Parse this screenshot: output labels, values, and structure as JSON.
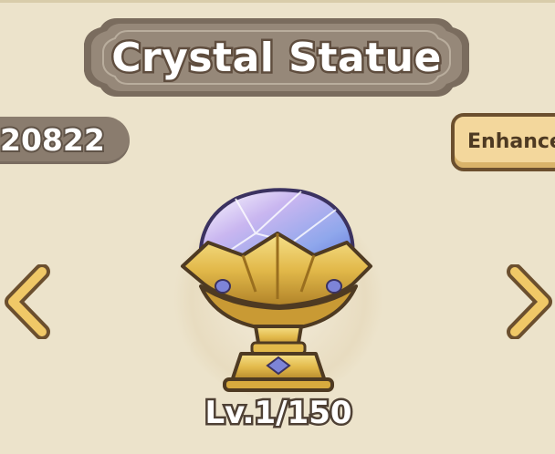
{
  "title": "Crystal Statue",
  "resource": {
    "value": "20822"
  },
  "enhance": {
    "label": "Enhance"
  },
  "statue": {
    "level": "Lv.1/150"
  },
  "icons": {
    "prev": "chevron-left-icon",
    "next": "chevron-right-icon",
    "statue": "crystal-statue-icon"
  },
  "colors": {
    "background": "#ece3cb",
    "plaque": "#8f8172",
    "accent_gold": "#e2b94a",
    "text_outline": "#5f4d3e"
  }
}
